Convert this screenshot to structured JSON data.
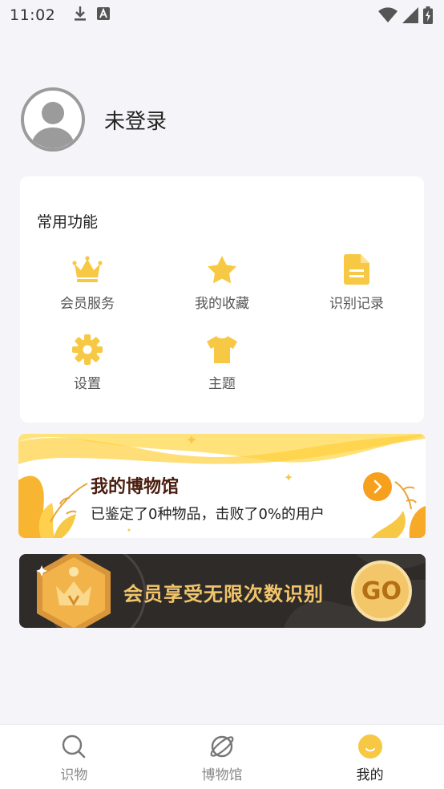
{
  "status_bar": {
    "time": "11:02",
    "icons_left": [
      "download-icon",
      "text-a-icon"
    ],
    "icons_right": [
      "wifi-icon",
      "signal-icon",
      "battery-charging-icon"
    ]
  },
  "profile": {
    "avatar_icon": "default-avatar-icon",
    "name": "未登录"
  },
  "functions": {
    "title": "常用功能",
    "items": [
      {
        "label": "会员服务",
        "icon": "crown-icon"
      },
      {
        "label": "我的收藏",
        "icon": "star-icon"
      },
      {
        "label": "识别记录",
        "icon": "document-icon"
      },
      {
        "label": "设置",
        "icon": "gear-icon"
      },
      {
        "label": "主题",
        "icon": "tshirt-icon"
      }
    ]
  },
  "museum_banner": {
    "title": "我的博物馆",
    "subtitle": "已鉴定了0种物品，击败了0%的用户",
    "arrow_icon": "chevron-right-icon"
  },
  "vip_banner": {
    "text": "会员享受无限次数识别",
    "button_label": "GO",
    "badge_icon": "vip-crown-badge-icon"
  },
  "bottom_nav": {
    "items": [
      {
        "label": "识物",
        "icon": "search-icon",
        "active": false
      },
      {
        "label": "博物馆",
        "icon": "planet-icon",
        "active": false
      },
      {
        "label": "我的",
        "icon": "smile-face-icon",
        "active": true
      }
    ]
  },
  "colors": {
    "accent": "#f7c844",
    "background": "#f5f5f9",
    "museum_title": "#4a1e10",
    "vip_background": "#2e2b29",
    "vip_text": "#f2c56b"
  }
}
